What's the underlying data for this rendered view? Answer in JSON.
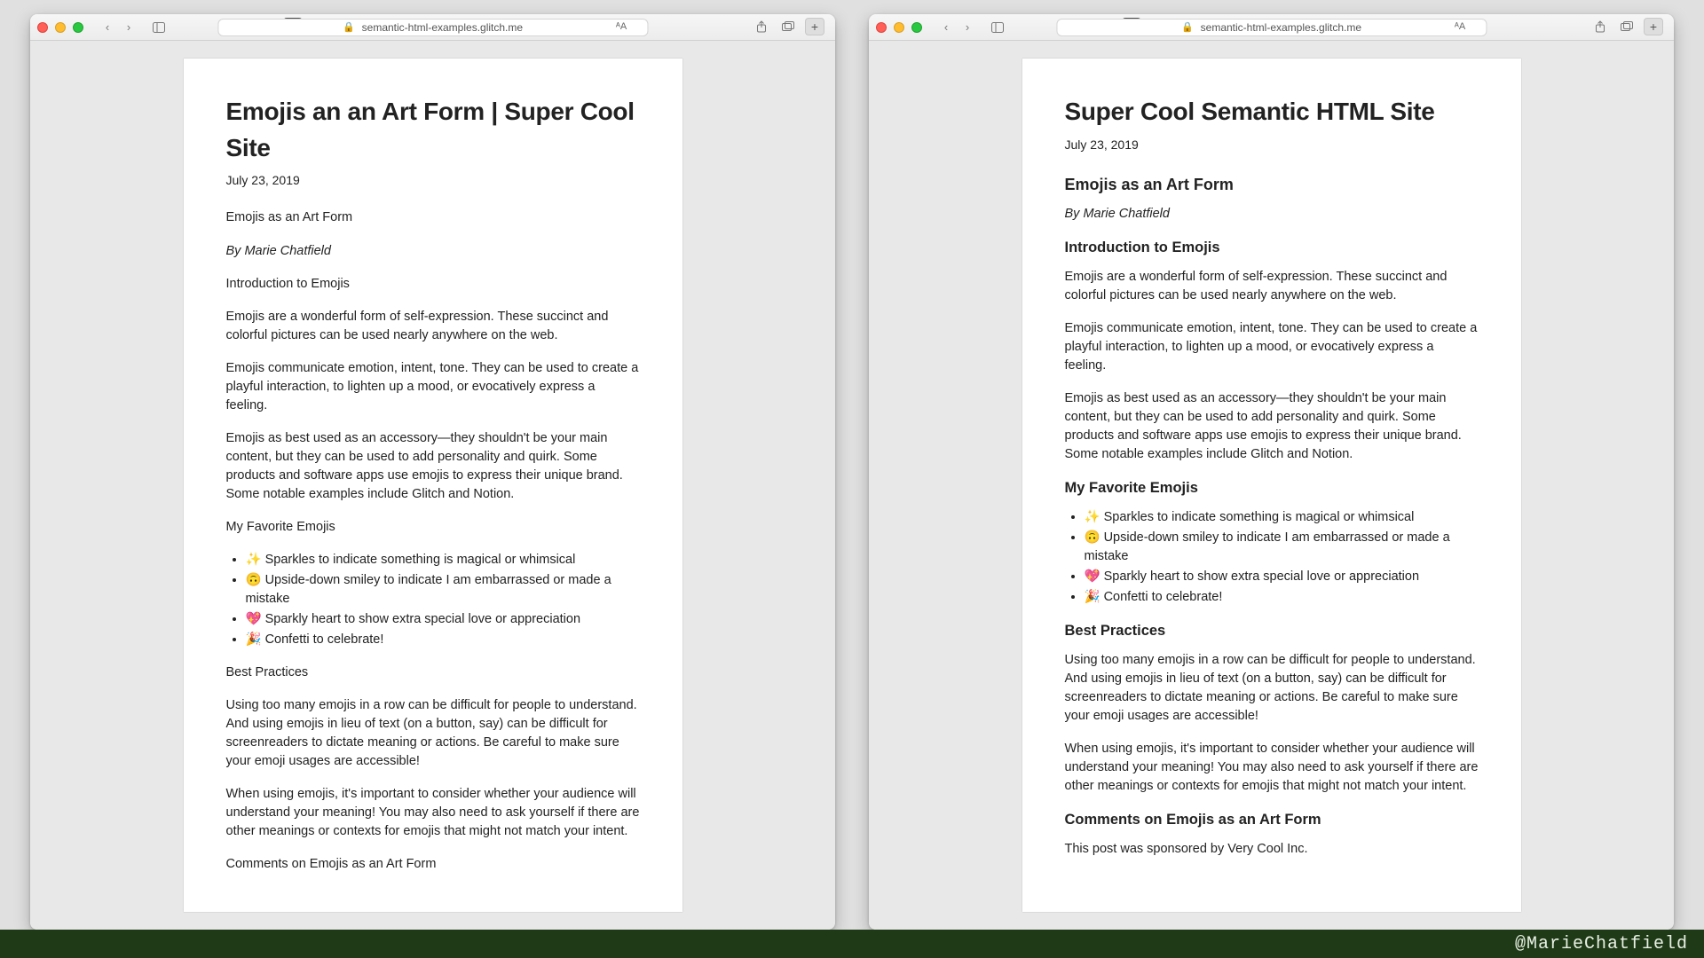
{
  "footer": {
    "handle": "@MarieChatfield"
  },
  "browser": {
    "url_text": "semantic-html-examples.glitch.me"
  },
  "left": {
    "title": "Emojis an an Art Form | Super Cool Site",
    "date": "July 23, 2019",
    "h_article": "Emojis as an Art Form",
    "byline": "By Marie Chatfield",
    "h_intro": "Introduction to Emojis",
    "p_intro1": "Emojis are a wonderful form of self-expression. These succinct and colorful pictures can be used nearly anywhere on the web.",
    "p_intro2": "Emojis communicate emotion, intent, tone. They can be used to create a playful interaction, to lighten up a mood, or evocatively express a feeling.",
    "p_intro3": "Emojis as best used as an accessory—they shouldn't be your main content, but they can be used to add personality and quirk. Some products and software apps use emojis to express their unique brand. Some notable examples include Glitch and Notion.",
    "h_fav": "My Favorite Emojis",
    "fav_items": [
      "✨ Sparkles to indicate something is magical or whimsical",
      "🙃 Upside-down smiley to indicate I am embarrassed or made a mistake",
      "💖 Sparkly heart to show extra special love or appreciation",
      "🎉 Confetti to celebrate!"
    ],
    "h_bp": "Best Practices",
    "p_bp1": "Using too many emojis in a row can be difficult for people to understand. And using emojis in lieu of text (on a button, say) can be difficult for screenreaders to dictate meaning or actions. Be careful to make sure your emoji usages are accessible!",
    "p_bp2": "When using emojis, it's important to consider whether your audience will understand your meaning! You may also need to ask yourself if there are other meanings or contexts for emojis that might not match your intent.",
    "h_comments": "Comments on Emojis as an Art Form"
  },
  "right": {
    "title": "Super Cool Semantic HTML Site",
    "date": "July 23, 2019",
    "h_article": "Emojis as an Art Form",
    "byline": "By Marie Chatfield",
    "h_intro": "Introduction to Emojis",
    "p_intro1": "Emojis are a wonderful form of self-expression. These succinct and colorful pictures can be used nearly anywhere on the web.",
    "p_intro2": "Emojis communicate emotion, intent, tone. They can be used to create a playful interaction, to lighten up a mood, or evocatively express a feeling.",
    "p_intro3": "Emojis as best used as an accessory—they shouldn't be your main content, but they can be used to add personality and quirk. Some products and software apps use emojis to express their unique brand. Some notable examples include Glitch and Notion.",
    "h_fav": "My Favorite Emojis",
    "fav_items": [
      "✨ Sparkles to indicate something is magical or whimsical",
      "🙃 Upside-down smiley to indicate I am embarrassed or made a mistake",
      "💖 Sparkly heart to show extra special love or appreciation",
      "🎉 Confetti to celebrate!"
    ],
    "h_bp": "Best Practices",
    "p_bp1": "Using too many emojis in a row can be difficult for people to understand. And using emojis in lieu of text (on a button, say) can be difficult for screenreaders to dictate meaning or actions. Be careful to make sure your emoji usages are accessible!",
    "p_bp2": "When using emojis, it's important to consider whether your audience will understand your meaning! You may also need to ask yourself if there are other meanings or contexts for emojis that might not match your intent.",
    "h_comments": "Comments on Emojis as an Art Form",
    "sponsor": "This post was sponsored by Very Cool Inc."
  }
}
